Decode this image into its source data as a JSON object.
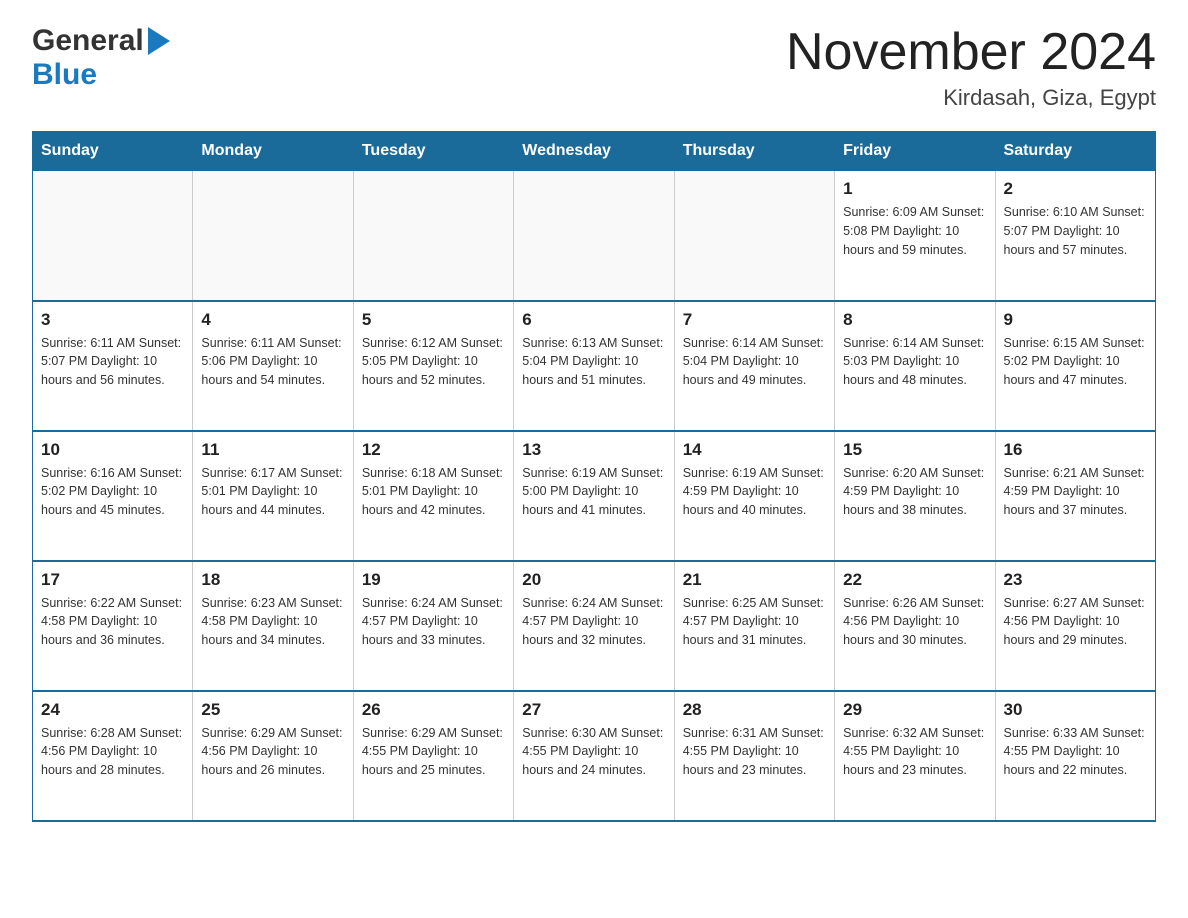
{
  "header": {
    "logo_general": "General",
    "logo_blue": "Blue",
    "month_title": "November 2024",
    "location": "Kirdasah, Giza, Egypt"
  },
  "days_of_week": [
    "Sunday",
    "Monday",
    "Tuesday",
    "Wednesday",
    "Thursday",
    "Friday",
    "Saturday"
  ],
  "weeks": [
    [
      {
        "day": "",
        "info": ""
      },
      {
        "day": "",
        "info": ""
      },
      {
        "day": "",
        "info": ""
      },
      {
        "day": "",
        "info": ""
      },
      {
        "day": "",
        "info": ""
      },
      {
        "day": "1",
        "info": "Sunrise: 6:09 AM\nSunset: 5:08 PM\nDaylight: 10 hours\nand 59 minutes."
      },
      {
        "day": "2",
        "info": "Sunrise: 6:10 AM\nSunset: 5:07 PM\nDaylight: 10 hours\nand 57 minutes."
      }
    ],
    [
      {
        "day": "3",
        "info": "Sunrise: 6:11 AM\nSunset: 5:07 PM\nDaylight: 10 hours\nand 56 minutes."
      },
      {
        "day": "4",
        "info": "Sunrise: 6:11 AM\nSunset: 5:06 PM\nDaylight: 10 hours\nand 54 minutes."
      },
      {
        "day": "5",
        "info": "Sunrise: 6:12 AM\nSunset: 5:05 PM\nDaylight: 10 hours\nand 52 minutes."
      },
      {
        "day": "6",
        "info": "Sunrise: 6:13 AM\nSunset: 5:04 PM\nDaylight: 10 hours\nand 51 minutes."
      },
      {
        "day": "7",
        "info": "Sunrise: 6:14 AM\nSunset: 5:04 PM\nDaylight: 10 hours\nand 49 minutes."
      },
      {
        "day": "8",
        "info": "Sunrise: 6:14 AM\nSunset: 5:03 PM\nDaylight: 10 hours\nand 48 minutes."
      },
      {
        "day": "9",
        "info": "Sunrise: 6:15 AM\nSunset: 5:02 PM\nDaylight: 10 hours\nand 47 minutes."
      }
    ],
    [
      {
        "day": "10",
        "info": "Sunrise: 6:16 AM\nSunset: 5:02 PM\nDaylight: 10 hours\nand 45 minutes."
      },
      {
        "day": "11",
        "info": "Sunrise: 6:17 AM\nSunset: 5:01 PM\nDaylight: 10 hours\nand 44 minutes."
      },
      {
        "day": "12",
        "info": "Sunrise: 6:18 AM\nSunset: 5:01 PM\nDaylight: 10 hours\nand 42 minutes."
      },
      {
        "day": "13",
        "info": "Sunrise: 6:19 AM\nSunset: 5:00 PM\nDaylight: 10 hours\nand 41 minutes."
      },
      {
        "day": "14",
        "info": "Sunrise: 6:19 AM\nSunset: 4:59 PM\nDaylight: 10 hours\nand 40 minutes."
      },
      {
        "day": "15",
        "info": "Sunrise: 6:20 AM\nSunset: 4:59 PM\nDaylight: 10 hours\nand 38 minutes."
      },
      {
        "day": "16",
        "info": "Sunrise: 6:21 AM\nSunset: 4:59 PM\nDaylight: 10 hours\nand 37 minutes."
      }
    ],
    [
      {
        "day": "17",
        "info": "Sunrise: 6:22 AM\nSunset: 4:58 PM\nDaylight: 10 hours\nand 36 minutes."
      },
      {
        "day": "18",
        "info": "Sunrise: 6:23 AM\nSunset: 4:58 PM\nDaylight: 10 hours\nand 34 minutes."
      },
      {
        "day": "19",
        "info": "Sunrise: 6:24 AM\nSunset: 4:57 PM\nDaylight: 10 hours\nand 33 minutes."
      },
      {
        "day": "20",
        "info": "Sunrise: 6:24 AM\nSunset: 4:57 PM\nDaylight: 10 hours\nand 32 minutes."
      },
      {
        "day": "21",
        "info": "Sunrise: 6:25 AM\nSunset: 4:57 PM\nDaylight: 10 hours\nand 31 minutes."
      },
      {
        "day": "22",
        "info": "Sunrise: 6:26 AM\nSunset: 4:56 PM\nDaylight: 10 hours\nand 30 minutes."
      },
      {
        "day": "23",
        "info": "Sunrise: 6:27 AM\nSunset: 4:56 PM\nDaylight: 10 hours\nand 29 minutes."
      }
    ],
    [
      {
        "day": "24",
        "info": "Sunrise: 6:28 AM\nSunset: 4:56 PM\nDaylight: 10 hours\nand 28 minutes."
      },
      {
        "day": "25",
        "info": "Sunrise: 6:29 AM\nSunset: 4:56 PM\nDaylight: 10 hours\nand 26 minutes."
      },
      {
        "day": "26",
        "info": "Sunrise: 6:29 AM\nSunset: 4:55 PM\nDaylight: 10 hours\nand 25 minutes."
      },
      {
        "day": "27",
        "info": "Sunrise: 6:30 AM\nSunset: 4:55 PM\nDaylight: 10 hours\nand 24 minutes."
      },
      {
        "day": "28",
        "info": "Sunrise: 6:31 AM\nSunset: 4:55 PM\nDaylight: 10 hours\nand 23 minutes."
      },
      {
        "day": "29",
        "info": "Sunrise: 6:32 AM\nSunset: 4:55 PM\nDaylight: 10 hours\nand 23 minutes."
      },
      {
        "day": "30",
        "info": "Sunrise: 6:33 AM\nSunset: 4:55 PM\nDaylight: 10 hours\nand 22 minutes."
      }
    ]
  ]
}
